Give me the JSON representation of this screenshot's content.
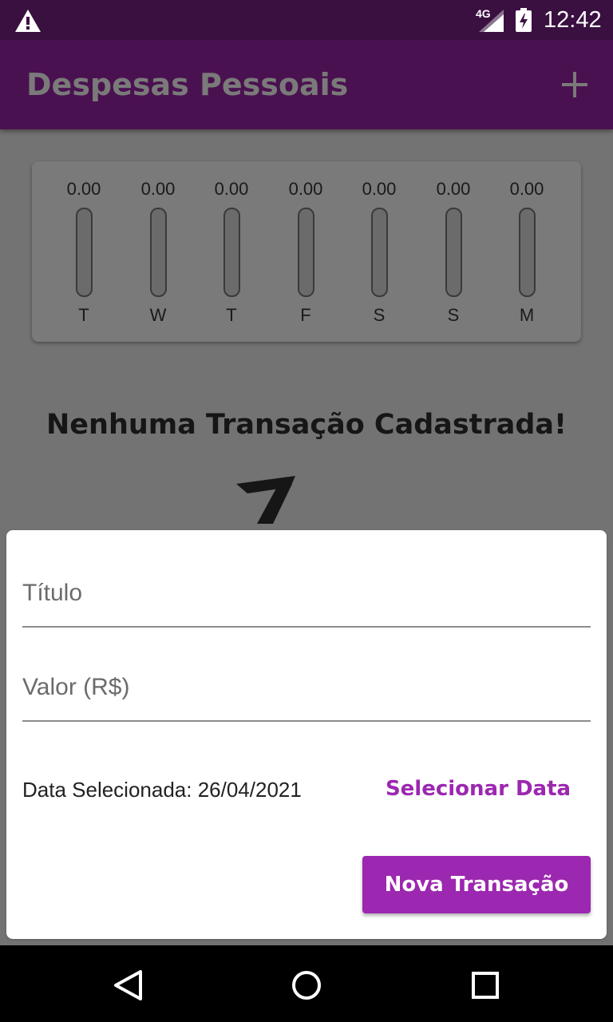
{
  "status_bar": {
    "network": "4G",
    "time": "12:42",
    "icons": [
      "warning-icon",
      "signal-icon",
      "battery-charging-icon"
    ]
  },
  "app_bar": {
    "title": "Despesas Pessoais",
    "add_icon": "plus-icon"
  },
  "chart": {
    "days": [
      {
        "day": "T",
        "amount": "0.00",
        "fill": 0
      },
      {
        "day": "W",
        "amount": "0.00",
        "fill": 0
      },
      {
        "day": "T",
        "amount": "0.00",
        "fill": 0
      },
      {
        "day": "F",
        "amount": "0.00",
        "fill": 0
      },
      {
        "day": "S",
        "amount": "0.00",
        "fill": 0
      },
      {
        "day": "S",
        "amount": "0.00",
        "fill": 0
      },
      {
        "day": "M",
        "amount": "0.00",
        "fill": 0
      }
    ]
  },
  "empty_state": {
    "message": "Nenhuma Transação Cadastrada!"
  },
  "form": {
    "title_placeholder": "Título",
    "value_placeholder": "Valor (R$)",
    "date_label": "Data Selecionada: 26/04/2021",
    "select_date_label": "Selecionar Data",
    "submit_label": "Nova Transação"
  },
  "colors": {
    "primary": "#9c27b0",
    "status_bar": "#3a1040",
    "app_bar": "#4a1150",
    "overlay": "#737373"
  },
  "nav_bar": {
    "icons": [
      "back-icon",
      "home-icon",
      "recents-icon"
    ]
  }
}
